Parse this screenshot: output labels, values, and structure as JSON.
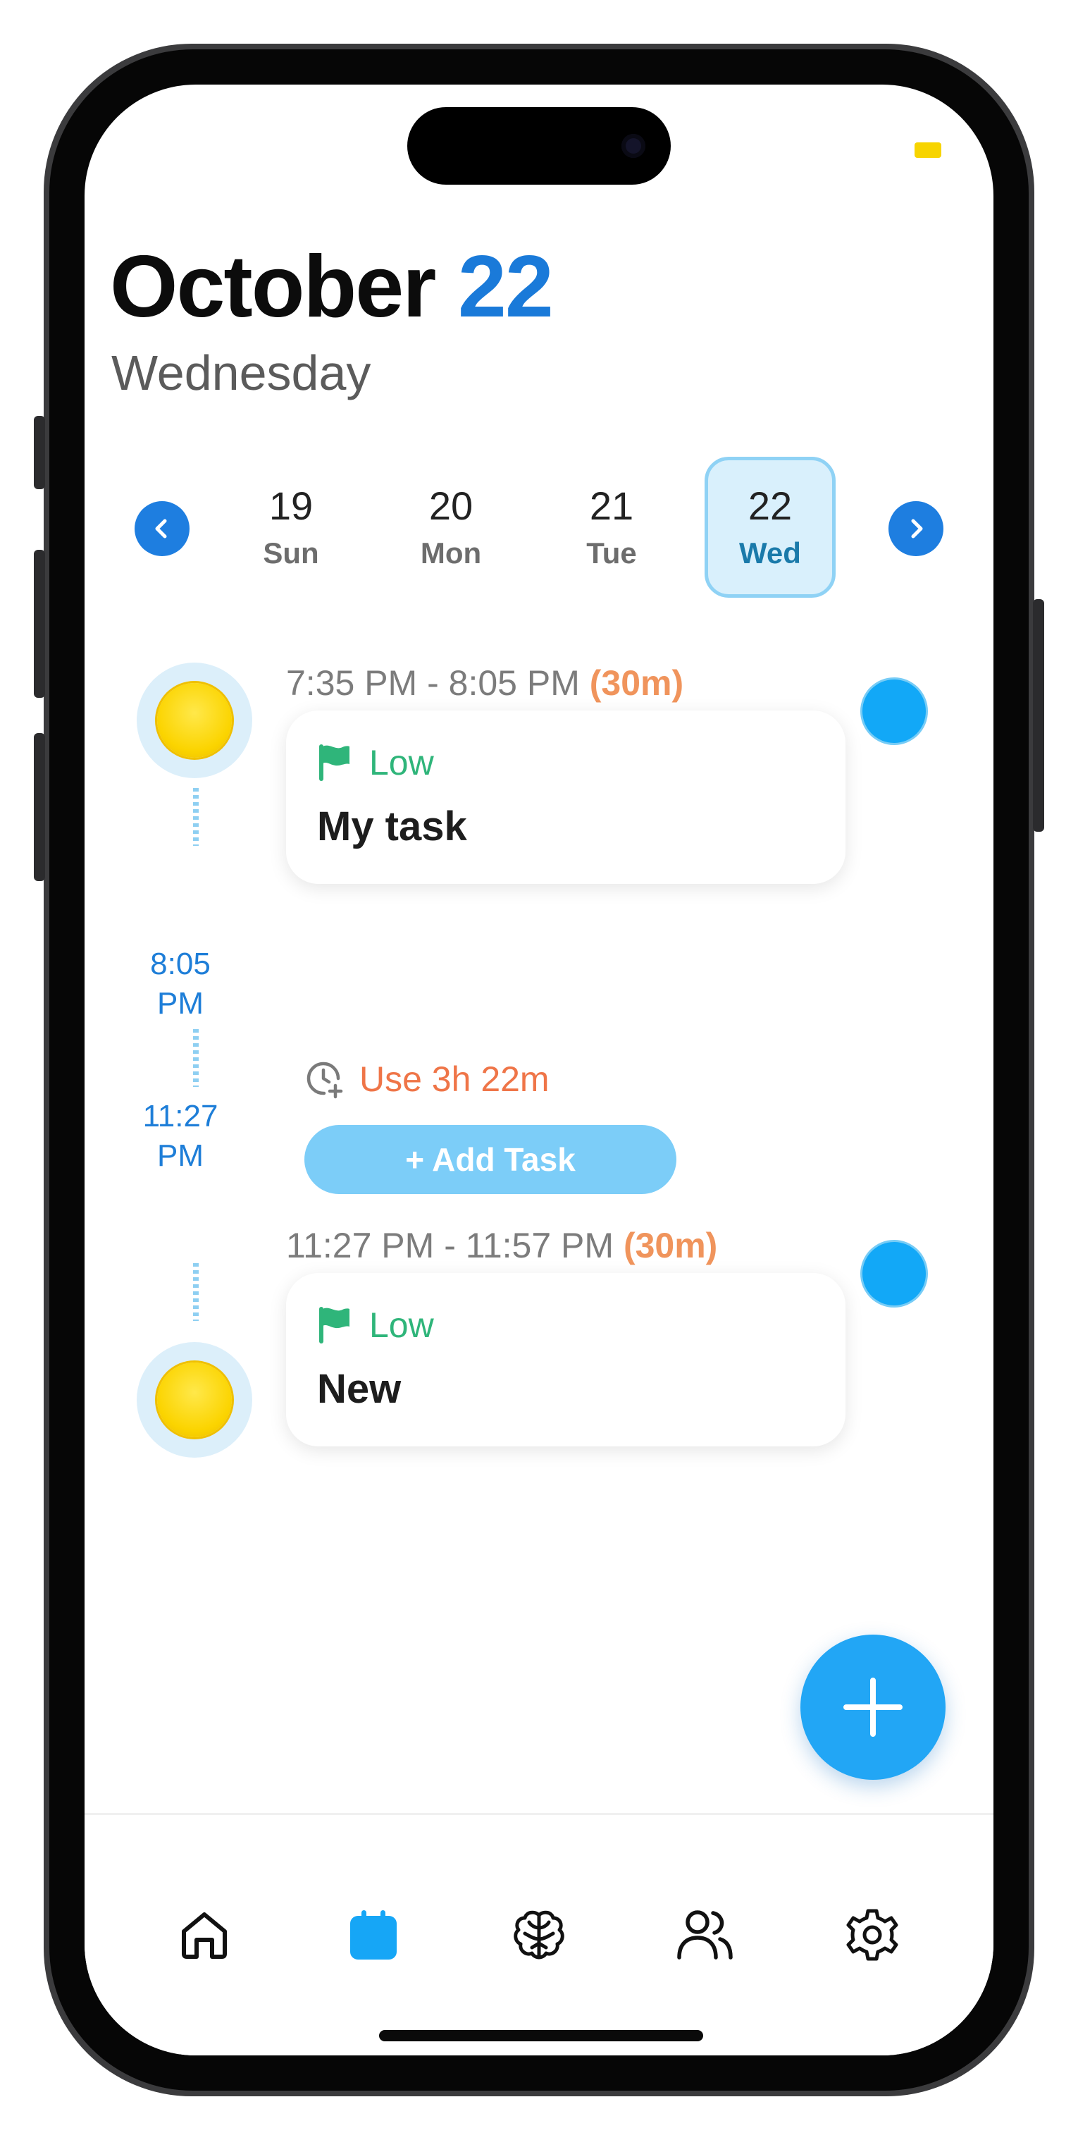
{
  "header": {
    "month": "October",
    "day_number": "22",
    "weekday": "Wednesday"
  },
  "week_strip": {
    "days": [
      {
        "num": "19",
        "dow": "Sun",
        "selected": false
      },
      {
        "num": "20",
        "dow": "Mon",
        "selected": false
      },
      {
        "num": "21",
        "dow": "Tue",
        "selected": false
      },
      {
        "num": "22",
        "dow": "Wed",
        "selected": true
      }
    ],
    "prev_icon": "chevron-left-icon",
    "next_icon": "chevron-right-icon"
  },
  "tasks": [
    {
      "time_range": "7:35 PM - 8:05 PM",
      "duration": "(30m)",
      "priority": "Low",
      "title": "My task",
      "icon": "sun-icon"
    },
    {
      "time_range": "11:27 PM - 11:57 PM",
      "duration": "(30m)",
      "priority": "Low",
      "title": "New",
      "icon": "sun-icon"
    }
  ],
  "free_slot": {
    "start": "8:05",
    "start_ampm": "PM",
    "end": "11:27",
    "end_ampm": "PM",
    "use_label": "Use 3h 22m",
    "add_task_label": "+ Add Task"
  },
  "tabbar": {
    "items": [
      "home-icon",
      "calendar-icon",
      "brain-icon",
      "users-icon",
      "gear-icon"
    ],
    "active": "calendar-icon"
  },
  "colors": {
    "accent": "#1a7ad9",
    "status_circle": "#12a8f7",
    "priority_low": "#2fb57a",
    "duration": "#f0945c",
    "use_time": "#ef7548",
    "add_task_button": "#7ccdf8",
    "fab": "#22a6f5"
  }
}
